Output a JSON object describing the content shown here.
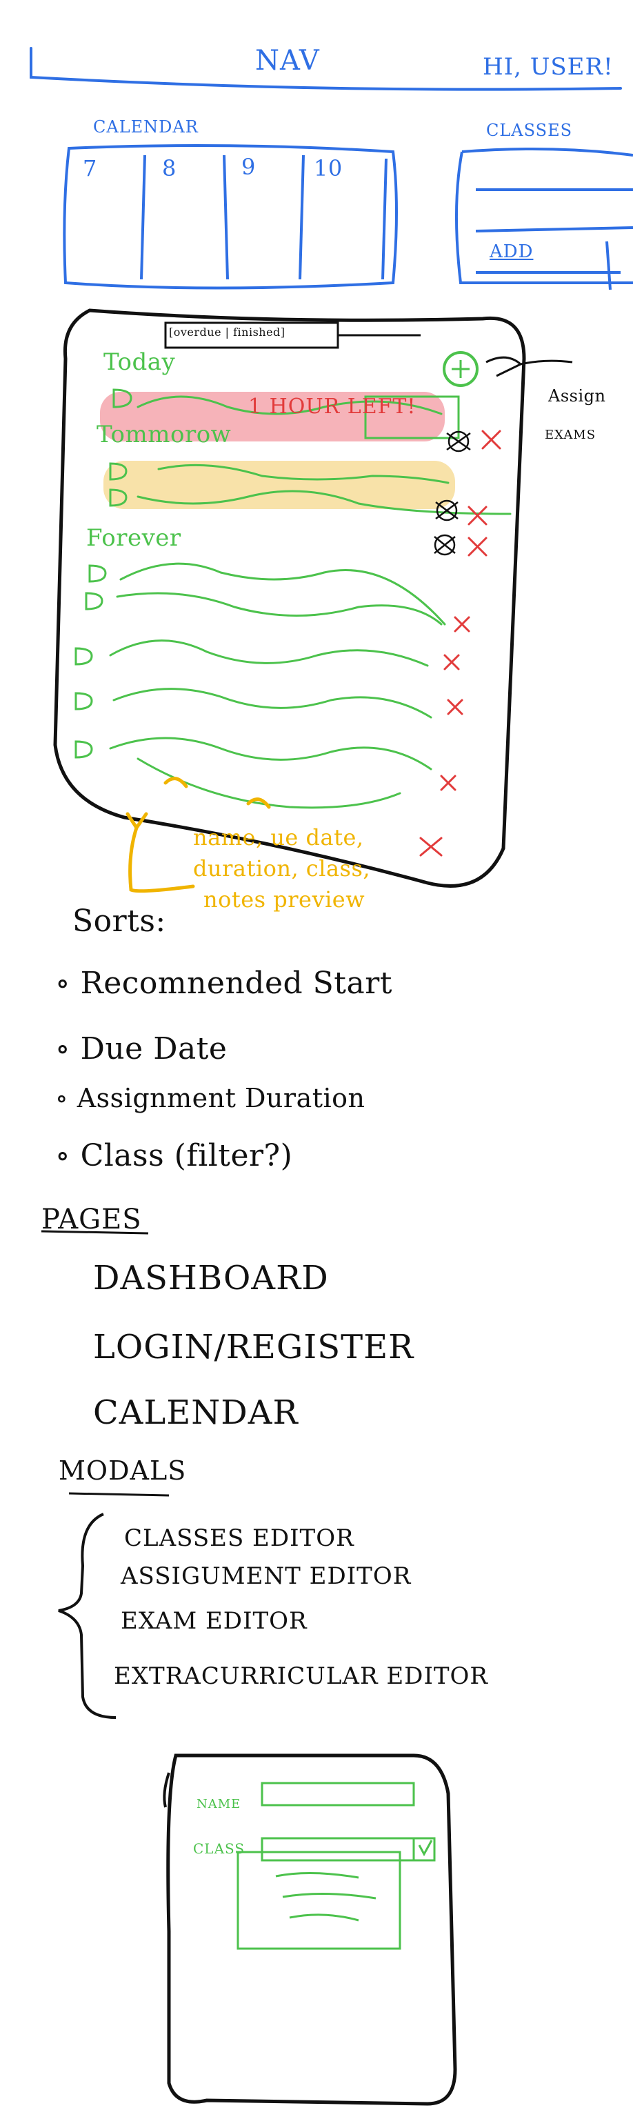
{
  "nav": {
    "title": "NAV",
    "greeting": "HI, USER!"
  },
  "calendar": {
    "label": "CALENDAR",
    "days": [
      "7",
      "8",
      "9",
      "10"
    ]
  },
  "classes": {
    "label": "CLASSES",
    "add_label": "ADD"
  },
  "tasks": {
    "header_toggle": "[overdue | finished]",
    "side_labels": [
      "Assign",
      "Exams"
    ],
    "sections": [
      "Today",
      "Tommorow",
      "Forever"
    ],
    "urgent_note": "1 HOUR LEFT!",
    "item_fields_note_line1": "name, ue date,",
    "item_fields_note_line2": "duration, class,",
    "item_fields_note_line3": "notes preview"
  },
  "sorts": {
    "title": "Sorts:",
    "items": [
      "Recomnended Start",
      "Due Date",
      "Assignment Duration",
      "Class (filter?)"
    ]
  },
  "pages": {
    "title": "PAGES",
    "items": [
      "DASHBOARD",
      "LOGIN/REGISTER",
      "CALENDAR"
    ]
  },
  "modals": {
    "title": "MODALS",
    "items": [
      "CLASSES EDITOR",
      "ASSIGUMENT EDITOR",
      "EXAM EDITOR",
      "EXTRACURRICULAR EDITOR"
    ]
  },
  "modal_mock": {
    "name_label": "NAME",
    "class_label": "CLASS"
  },
  "colors": {
    "sketch_blue": "#2f6fe4",
    "sketch_green": "#4cc24c",
    "sketch_red": "#e23b3b",
    "highlight_red": "#f4a6ad",
    "highlight_yellow": "#f7dfa0",
    "sketch_yellow": "#f0b400"
  }
}
